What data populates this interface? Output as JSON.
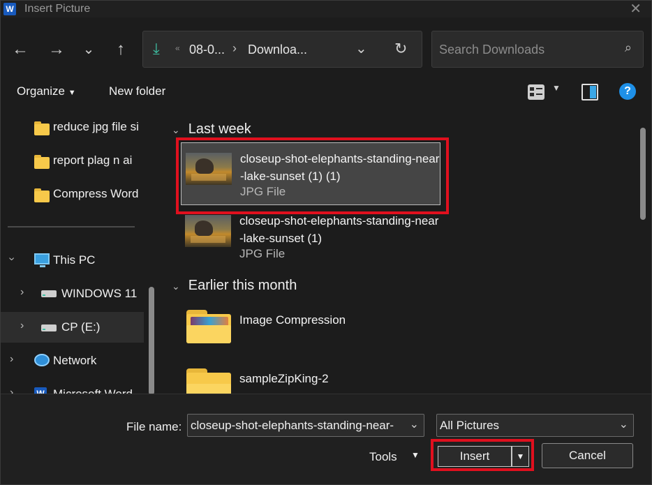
{
  "window": {
    "title": "Insert Picture",
    "app_icon": "W"
  },
  "nav": {
    "back": "←",
    "forward": "→",
    "recent": "⌄",
    "up": "↑"
  },
  "address": {
    "icon": "⤓",
    "overflow": "«",
    "segments": [
      "08-0...",
      "Downloa..."
    ],
    "separator": "›",
    "dropdown": "⌄",
    "refresh": "↻"
  },
  "search": {
    "placeholder": "Search Downloads",
    "icon": "⌕"
  },
  "commandbar": {
    "organize": "Organize",
    "new_folder": "New folder",
    "help": "?"
  },
  "sidebar": {
    "items": [
      {
        "label": "reduce jpg file si"
      },
      {
        "label": "report plag n ai"
      },
      {
        "label": "Compress Word"
      },
      {
        "label": "This PC"
      },
      {
        "label": "WINDOWS 11"
      },
      {
        "label": "CP (E:)"
      },
      {
        "label": "Network"
      },
      {
        "label": "Microsoft Word"
      }
    ]
  },
  "groups": [
    {
      "header": "Last week",
      "items": [
        {
          "name": "closeup-shot-elephants-standing-near-lake-sunset (1) (1)",
          "type": "JPG File"
        },
        {
          "name": "closeup-shot-elephants-standing-near-lake-sunset (1)",
          "type": "JPG File"
        }
      ]
    },
    {
      "header": "Earlier this month",
      "items": [
        {
          "name": "Image Compression"
        },
        {
          "name": "sampleZipKing-2"
        }
      ]
    }
  ],
  "footer": {
    "file_name_label": "File name:",
    "file_name_value": "closeup-shot-elephants-standing-near-",
    "filter": "All Pictures",
    "tools": "Tools",
    "insert": "Insert",
    "cancel": "Cancel"
  },
  "colors": {
    "highlight": "#e0101e",
    "accent": "#3ec1a4",
    "folder": "#f7c94a",
    "background": "#1c1c1c"
  }
}
